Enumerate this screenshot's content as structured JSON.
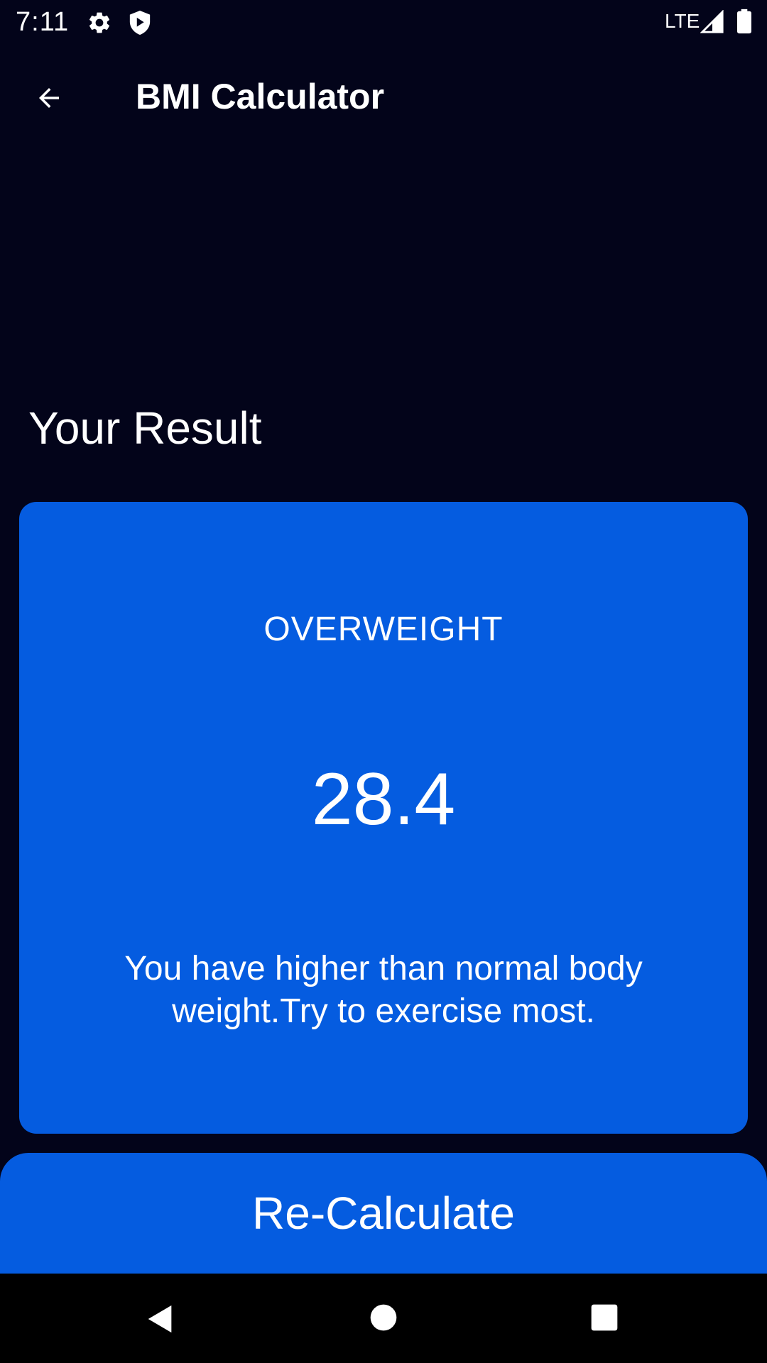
{
  "status_bar": {
    "time": "7:11",
    "network": "LTE",
    "icons": [
      "gear-icon",
      "shield-icon",
      "signal-icon",
      "battery-icon"
    ]
  },
  "app_bar": {
    "title": "BMI Calculator",
    "back_icon": "arrow-left-icon"
  },
  "main": {
    "heading": "Your Result",
    "result": {
      "status": "OVERWEIGHT",
      "bmi_value": "28.4",
      "message": "You have higher than normal body weight.Try to exercise most."
    },
    "recalculate_label": "Re-Calculate"
  },
  "nav_bar": {
    "icons": [
      "nav-back-icon",
      "nav-home-icon",
      "nav-recents-icon"
    ]
  },
  "colors": {
    "background": "#03041a",
    "card": "#055ce0",
    "text": "#ffffff",
    "nav_bar": "#000000"
  }
}
